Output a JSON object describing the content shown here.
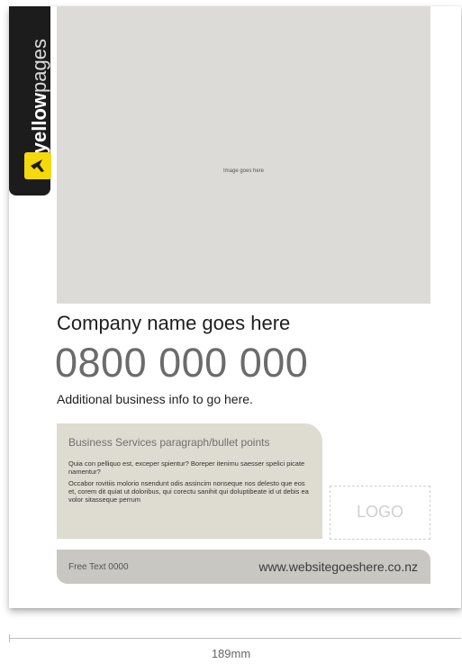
{
  "brand": {
    "name_bold": "yellow",
    "name_light": "pages",
    "logo_color": "#f5d90c",
    "tab_color": "#1c1c1c",
    "logo_icon": "yellowpages-walking-fingers-icon"
  },
  "image_placeholder": {
    "label": "Image goes here",
    "color": "#dcdbd8"
  },
  "company": {
    "name": "Company name goes here",
    "phone": "0800 000 000",
    "additional_info": "Additional business info to go here."
  },
  "services": {
    "title": "Business Services paragraph/bullet points",
    "paragraph_1": "Quia con pelliquo est, exceper spientur? Boreper itenimu saesser spelici picate namentur?",
    "paragraph_2": "Occabor rovitiis molorio nsendunt odis assincim nonseque nos delesto que eos et, corem dit quiat ut doloribus, qui corectu sanihit qui doluptibeate id ut debis ea volor sitasseque perrum",
    "color": "#dedbd0"
  },
  "logo_placeholder": {
    "label": "LOGO"
  },
  "footer": {
    "free_text": "Free Text 0000",
    "website": "www.websitegoeshere.co.nz",
    "color": "#c9c7c2"
  },
  "dimension": {
    "label": "189mm"
  }
}
